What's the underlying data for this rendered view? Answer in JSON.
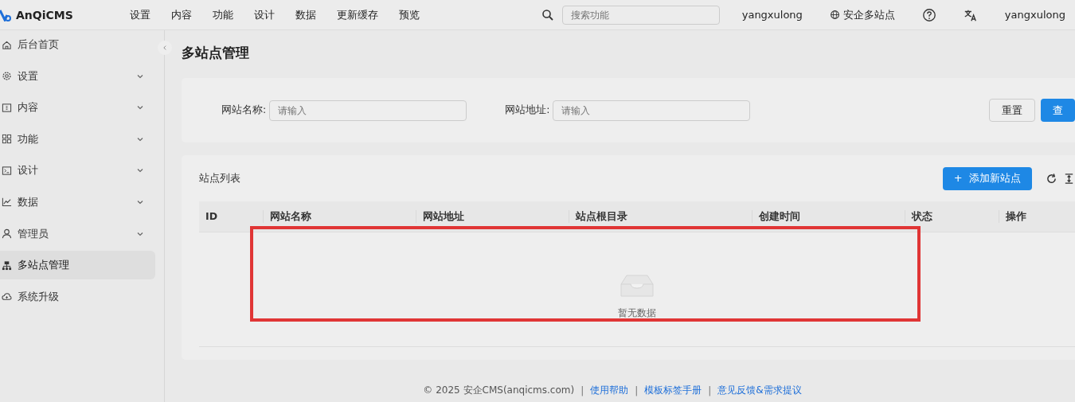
{
  "brand": "AnQiCMS",
  "top_nav": [
    "设置",
    "内容",
    "功能",
    "设计",
    "数据",
    "更新缓存",
    "预览"
  ],
  "search": {
    "placeholder": "搜索功能"
  },
  "header_items": [
    {
      "kind": "text",
      "label": "yangxulong"
    },
    {
      "kind": "globe",
      "label": "安企多站点"
    },
    {
      "kind": "help"
    },
    {
      "kind": "translate"
    },
    {
      "kind": "text",
      "label": "yangxulong"
    }
  ],
  "sidebar": {
    "items": [
      {
        "label": "后台首页",
        "expandable": false,
        "selected": false
      },
      {
        "label": "设置",
        "expandable": true,
        "selected": false
      },
      {
        "label": "内容",
        "expandable": true,
        "selected": false
      },
      {
        "label": "功能",
        "expandable": true,
        "selected": false
      },
      {
        "label": "设计",
        "expandable": true,
        "selected": false
      },
      {
        "label": "数据",
        "expandable": true,
        "selected": false
      },
      {
        "label": "管理员",
        "expandable": true,
        "selected": false
      },
      {
        "label": "多站点管理",
        "expandable": false,
        "selected": true
      },
      {
        "label": "系统升级",
        "expandable": false,
        "selected": false
      }
    ]
  },
  "page_title": "多站点管理",
  "filters": [
    {
      "label": "网站名称:",
      "placeholder": "请输入"
    },
    {
      "label": "网站地址:",
      "placeholder": "请输入"
    }
  ],
  "filter_buttons": [
    {
      "kind": "default",
      "label": "重置"
    },
    {
      "kind": "primary",
      "label": "查"
    }
  ],
  "table": {
    "title": "站点列表",
    "add_button": "+  添加新站点",
    "columns": [
      "ID",
      "网站名称",
      "网站地址",
      "站点根目录",
      "创建时间",
      "状态",
      "操作"
    ],
    "empty_text": "暂无数据"
  },
  "footer": {
    "copyright": "© 2025 安企CMS(anqicms.com)",
    "separator": "|",
    "links": [
      "使用帮助",
      "模板标签手册",
      "意见反馈&需求提议"
    ]
  }
}
